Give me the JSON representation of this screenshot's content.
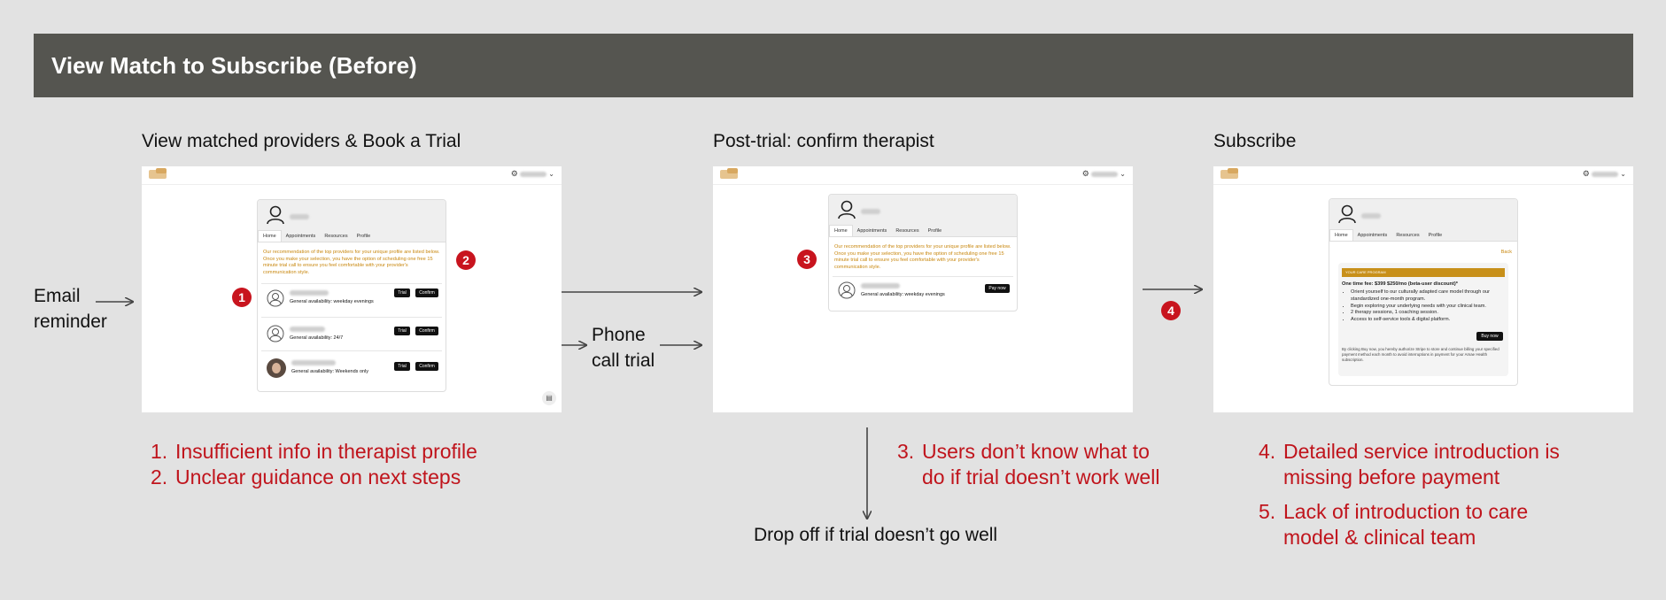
{
  "title": "View Match to Subscribe (Before)",
  "columns": {
    "c1": "View matched providers & Book a Trial",
    "c2": "Post-trial: confirm therapist",
    "c3": "Subscribe"
  },
  "labels": {
    "email_line1": "Email",
    "email_line2": "reminder",
    "phone_line1": "Phone",
    "phone_line2": "call trial",
    "drop_off": "Drop off if trial doesn’t go well"
  },
  "badges": [
    "1",
    "2",
    "3",
    "4"
  ],
  "screens": {
    "tabs": [
      "Home",
      "Appointments",
      "Resources",
      "Profile"
    ],
    "recommendation_text": "Our recommendation of the top providers for your unique profile are listed below. Once you make your selection, you have the option of scheduling one free 15 minute trial call to ensure you feel comfortable with your provider's communication style.",
    "s1_providers": [
      {
        "availability": "General availability: weekday evenings",
        "btn_a": "Trial",
        "btn_b": "Confirm"
      },
      {
        "availability": "General availability: 24/7",
        "btn_a": "Trial",
        "btn_b": "Confirm"
      },
      {
        "availability": "General availability: Weekends only",
        "btn_a": "Trial",
        "btn_b": "Confirm"
      }
    ],
    "s2_provider": {
      "availability": "General availability: weekday evenings",
      "btn": "Pay now"
    },
    "s3": {
      "back": "Back",
      "program_label": "YOUR CARE PROGRAM",
      "fee": "One time fee: $399 $250/mo (beta-user discount)*",
      "bullets": [
        "Orient yourself to our culturally adapted care model through our standardized one-month program.",
        "Begin exploring your underlying needs with your clinical team.",
        "2 therapy sessions, 1 coaching session.",
        "Access to self-service tools & digital platform."
      ],
      "buy": "Buy now",
      "fine_print": "By clicking Buy now, you hereby authorize Stripe to store and continue billing your specified payment method each month to avoid interruptions in payment for your Amae Health subscription."
    }
  },
  "issues": {
    "i1": [
      "1.",
      "Insufficient info in therapist profile"
    ],
    "i2": [
      "2.",
      "Unclear guidance on next steps"
    ],
    "i3": [
      "3.",
      "Users don’t know what to",
      "do if trial doesn’t work well"
    ],
    "i4": [
      "4.",
      "Detailed service introduction is",
      "missing before payment"
    ],
    "i5": [
      "5.",
      "Lack of introduction to care",
      "model & clinical team"
    ]
  },
  "colors": {
    "banner": "#555550",
    "background": "#e2e2e2",
    "issue_red": "#c0141c",
    "badge_red": "#c8141e",
    "accent_gold": "#c8901a"
  },
  "icons": [
    "user-avatar-icon",
    "gear-icon",
    "chevron-down-icon",
    "chat-icon",
    "arrow-right-icon",
    "arrow-down-icon"
  ]
}
